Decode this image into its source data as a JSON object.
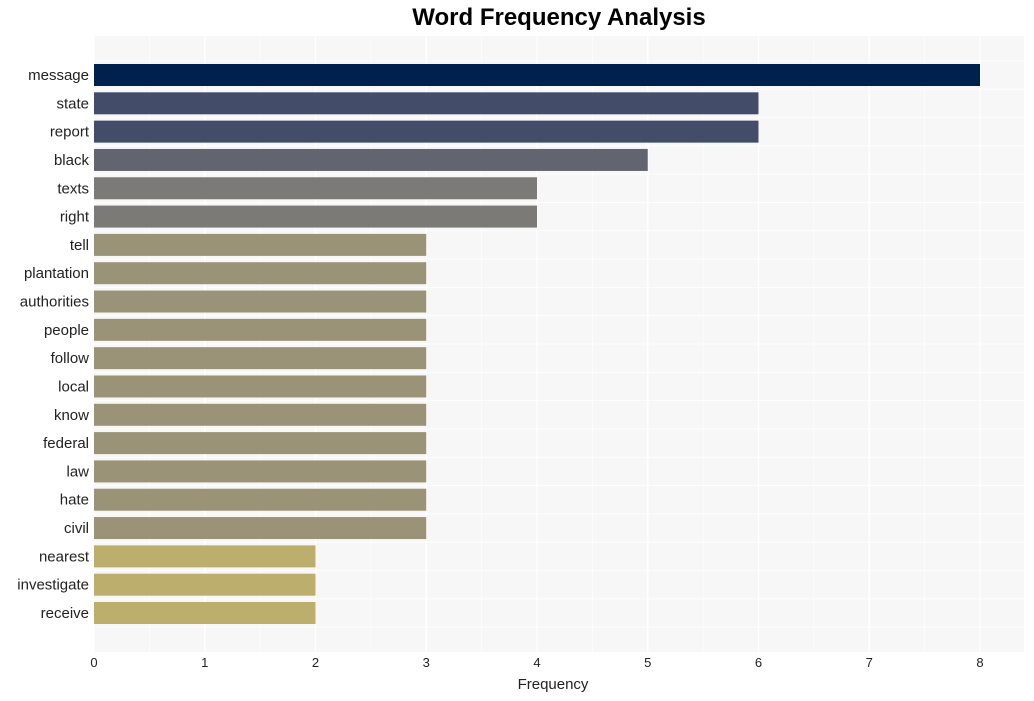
{
  "chart_data": {
    "type": "bar",
    "orientation": "horizontal",
    "title": "Word Frequency Analysis",
    "xlabel": "Frequency",
    "ylabel": "",
    "xlim": [
      0,
      8.4
    ],
    "xticks": [
      0,
      1,
      2,
      3,
      4,
      5,
      6,
      7,
      8
    ],
    "grid": true,
    "categories": [
      "message",
      "state",
      "report",
      "black",
      "texts",
      "right",
      "tell",
      "plantation",
      "authorities",
      "people",
      "follow",
      "local",
      "know",
      "federal",
      "law",
      "hate",
      "civil",
      "nearest",
      "investigate",
      "receive"
    ],
    "values": [
      8,
      6,
      6,
      5,
      4,
      4,
      3,
      3,
      3,
      3,
      3,
      3,
      3,
      3,
      3,
      3,
      3,
      2,
      2,
      2
    ],
    "colors": {
      "8": "#00204e",
      "6": "#434d6a",
      "5": "#62656f",
      "4": "#7b7a77",
      "3": "#9a9377",
      "2": "#bcae6d"
    },
    "plot_background": "#f7f7f7"
  }
}
